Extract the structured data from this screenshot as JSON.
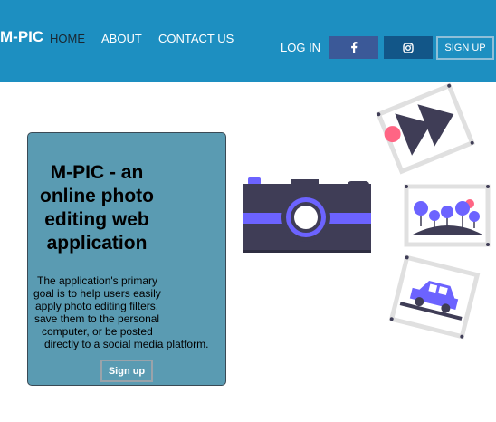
{
  "nav": {
    "brand": "M-PIC",
    "links": [
      "HOME",
      "ABOUT",
      "CONTACT US"
    ],
    "login": "LOG IN",
    "facebook_icon": "facebook-icon",
    "instagram_icon": "instagram-icon",
    "signup": "SIGN UP"
  },
  "hero": {
    "title_lines": [
      "M-PIC - an",
      "online photo",
      "editing web",
      "application"
    ],
    "description_lines": [
      "The application's primary",
      "goal is to help users easily",
      "apply photo editing filters,",
      "save them to the personal",
      "computer, or be posted",
      "directly to a social media platform."
    ],
    "signup": "Sign up"
  },
  "colors": {
    "navbar": "#1d8fc1",
    "card": "#5a9bb2",
    "camera_body": "#3f3d56",
    "accent": "#6c63ff",
    "highlight": "#ff6584"
  }
}
